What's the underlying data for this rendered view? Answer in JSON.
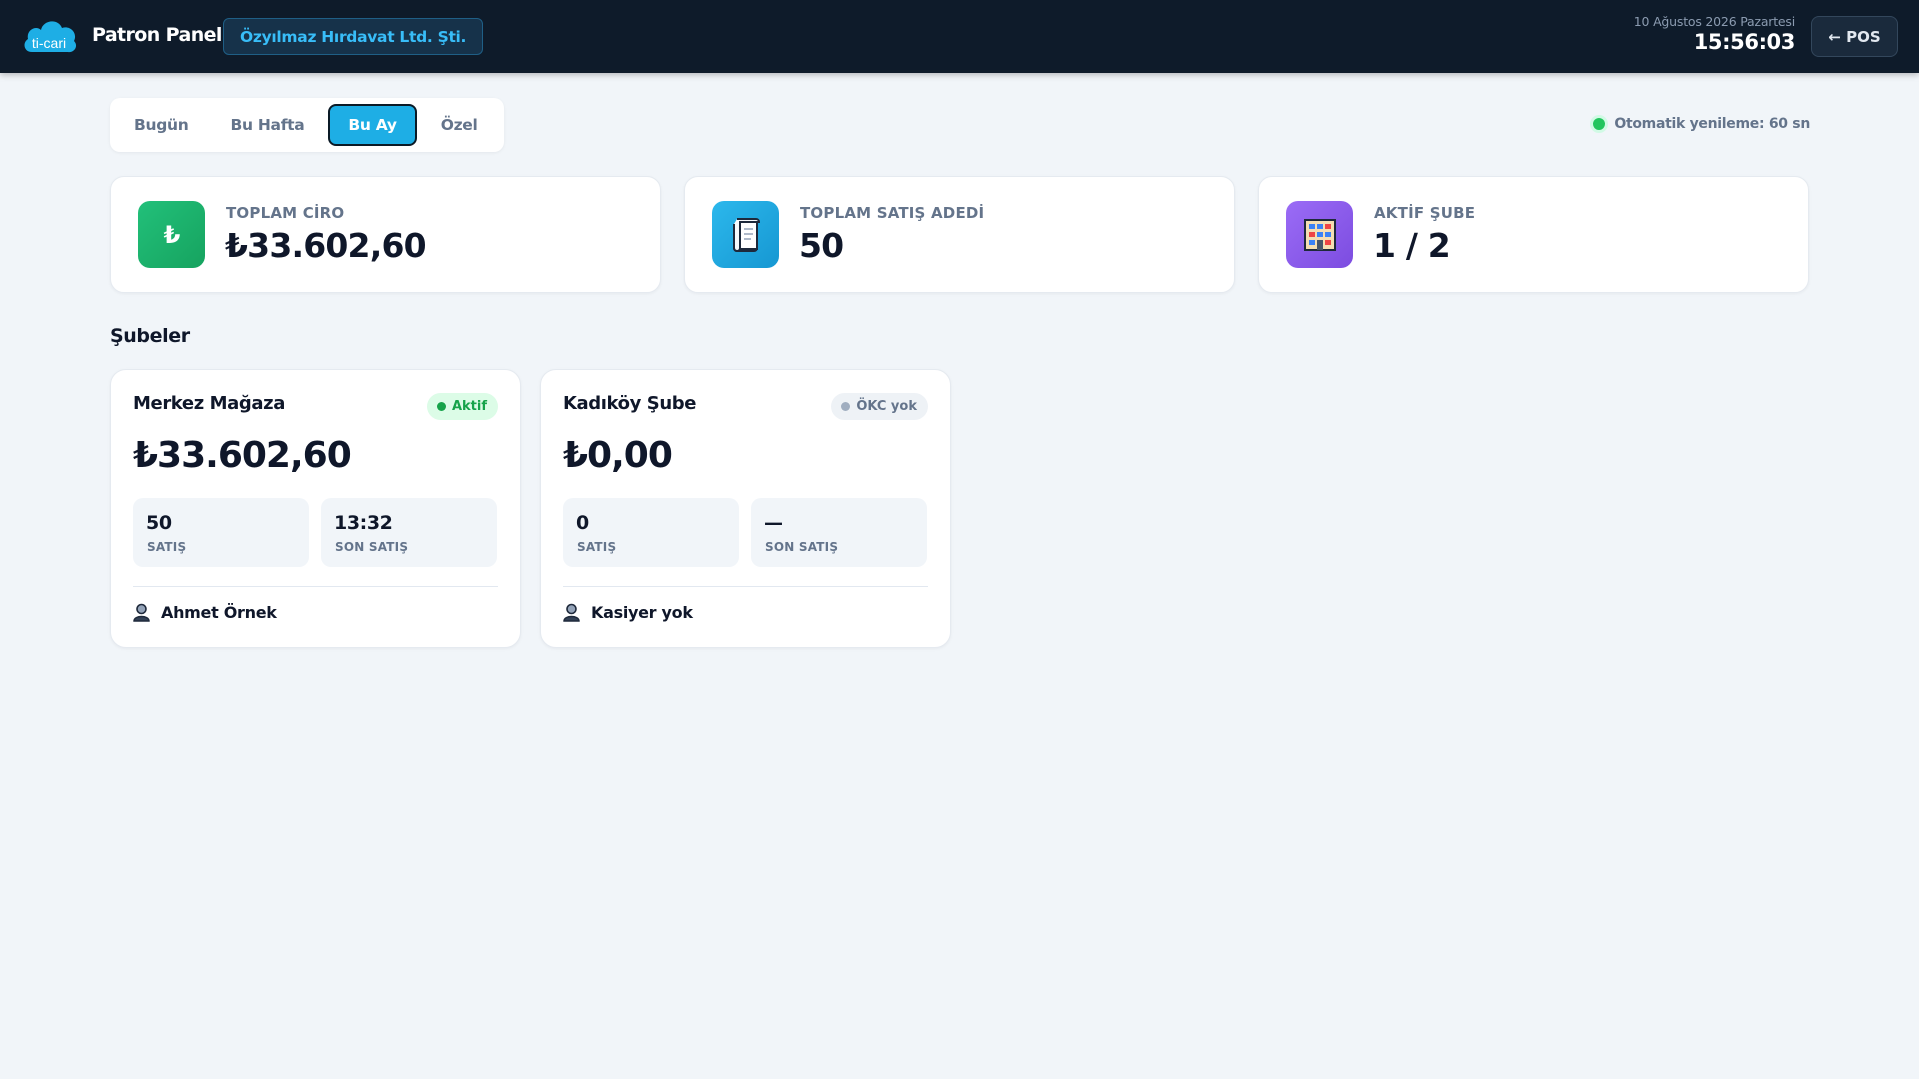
{
  "brand": {
    "logo_text": "ti-cari",
    "panel_title": "Patron Paneli"
  },
  "company": {
    "name": "Özyılmaz Hırdavat Ltd. Şti."
  },
  "clock": {
    "date": "10 Ağustos 2026 Pazartesi",
    "time": "15:56:03"
  },
  "pos_button": {
    "label": "← POS"
  },
  "period_tabs": [
    {
      "label": "Bugün",
      "active": false
    },
    {
      "label": "Bu Hafta",
      "active": false
    },
    {
      "label": "Bu Ay",
      "active": true
    },
    {
      "label": "Özel",
      "active": false
    }
  ],
  "refresh": {
    "label": "Otomatik yenileme: 60 sn"
  },
  "stats": [
    {
      "label": "TOPLAM CİRO",
      "value": "₺33.602,60",
      "icon": "lira-icon",
      "color": "#22b573"
    },
    {
      "label": "TOPLAM SATIŞ ADEDİ",
      "value": "50",
      "icon": "receipt-icon",
      "color": "#1eaee5"
    },
    {
      "label": "AKTİF ŞUBE",
      "value": "1 / 2",
      "icon": "building-icon",
      "color": "#8b5cf6"
    }
  ],
  "branches_section": {
    "title": "Şubeler"
  },
  "branches": [
    {
      "name": "Merkez Mağaza",
      "badge": "Aktif",
      "total": "₺33.602,60",
      "sales_count": "50",
      "sales_label": "SATIŞ",
      "last_sale": "13:32",
      "last_sale_label": "SON SATIŞ",
      "cashier": "Ahmet Örnek"
    },
    {
      "name": "Kadıköy Şube",
      "badge": "ÖKC yok",
      "total": "₺0,00",
      "sales_count": "0",
      "sales_label": "SATIŞ",
      "last_sale": "—",
      "last_sale_label": "SON SATIŞ",
      "cashier": "Kasiyer yok"
    }
  ]
}
